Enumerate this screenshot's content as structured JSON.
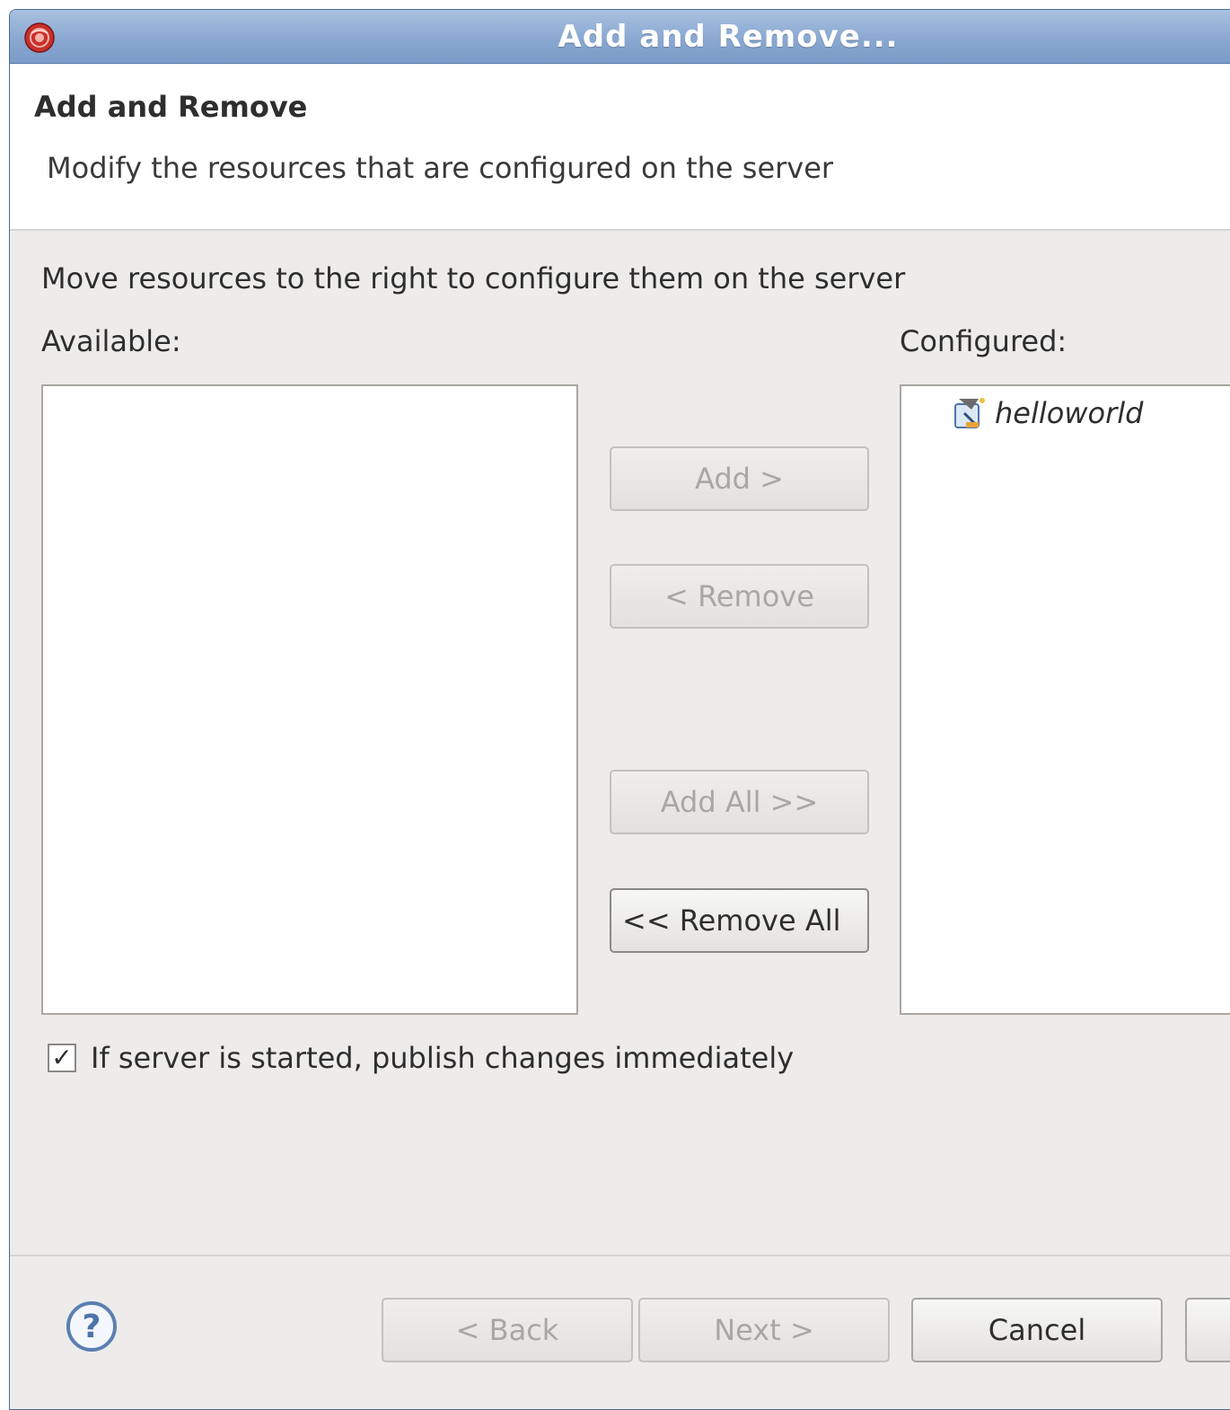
{
  "window": {
    "title": "Add and Remove..."
  },
  "header": {
    "title": "Add and Remove",
    "description": "Modify the resources that are configured on the server"
  },
  "instruction": "Move resources to the right to configure them on the server",
  "available": {
    "label": "Available:",
    "items": []
  },
  "configured": {
    "label": "Configured:",
    "items": [
      {
        "label": "helloworld",
        "icon": "web-module-icon"
      }
    ]
  },
  "buttons": {
    "add": "Add >",
    "remove": "< Remove",
    "add_all": "Add All >>",
    "remove_all": "<< Remove All"
  },
  "publish": {
    "label": "If server is started, publish changes immediately",
    "checked": true
  },
  "footer": {
    "help_icon": "help-icon",
    "back": "< Back",
    "next": "Next >",
    "cancel": "Cancel",
    "finish": ""
  },
  "colors": {
    "titlebar": "#87a6d0",
    "dialog_bg": "#edeceb",
    "disabled_text": "#a9a7a5",
    "help_blue": "#5b7fb2"
  }
}
